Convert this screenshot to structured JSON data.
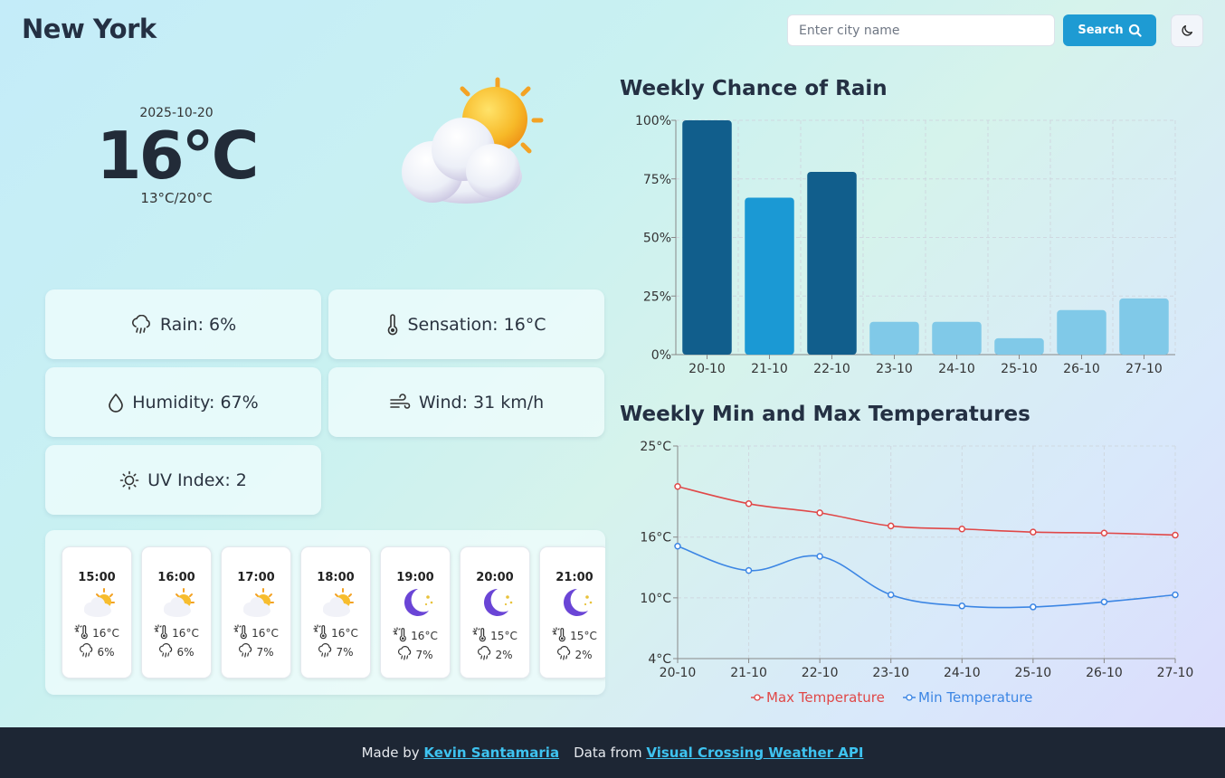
{
  "header": {
    "city": "New York",
    "search_placeholder": "Enter city name",
    "search_label": "Search"
  },
  "current": {
    "date": "2025-10-20",
    "temp": "16°C",
    "range": "13°C/20°C",
    "icon": "partly-cloudy-day-icon"
  },
  "details": {
    "rain": "Rain: 6%",
    "sensation": "Sensation: 16°C",
    "humidity": "Humidity: 67%",
    "wind": "Wind: 31 km/h",
    "uv": "UV Index: 2"
  },
  "hourly": [
    {
      "time": "15:00",
      "icon": "partly-cloudy-day",
      "temp": "16°C",
      "rain": "6%"
    },
    {
      "time": "16:00",
      "icon": "partly-cloudy-day",
      "temp": "16°C",
      "rain": "6%"
    },
    {
      "time": "17:00",
      "icon": "partly-cloudy-day",
      "temp": "16°C",
      "rain": "7%"
    },
    {
      "time": "18:00",
      "icon": "partly-cloudy-day",
      "temp": "16°C",
      "rain": "7%"
    },
    {
      "time": "19:00",
      "icon": "clear-night",
      "temp": "16°C",
      "rain": "7%"
    },
    {
      "time": "20:00",
      "icon": "clear-night",
      "temp": "15°C",
      "rain": "2%"
    },
    {
      "time": "21:00",
      "icon": "clear-night",
      "temp": "15°C",
      "rain": "2%"
    }
  ],
  "chart_data": [
    {
      "type": "bar",
      "title": "Weekly Chance of Rain",
      "categories": [
        "20-10",
        "21-10",
        "22-10",
        "23-10",
        "24-10",
        "25-10",
        "26-10",
        "27-10"
      ],
      "values": [
        100,
        67,
        78,
        14,
        14,
        7,
        19,
        24
      ],
      "ylim": [
        0,
        100
      ],
      "yticks": [
        "0%",
        "25%",
        "50%",
        "75%",
        "100%"
      ],
      "ytick_values": [
        0,
        25,
        50,
        75,
        100
      ],
      "grid": true,
      "colors": {
        "high": "#115e8c",
        "medium": "#1b99d4",
        "low": "#80c9e8"
      }
    },
    {
      "type": "line",
      "title": "Weekly Min and Max Temperatures",
      "categories": [
        "20-10",
        "21-10",
        "22-10",
        "23-10",
        "24-10",
        "25-10",
        "26-10",
        "27-10"
      ],
      "series": [
        {
          "name": "Max Temperature",
          "color": "#e04848",
          "values": [
            21,
            19.3,
            18.4,
            17.1,
            16.8,
            16.5,
            16.4,
            16.2
          ]
        },
        {
          "name": "Min Temperature",
          "color": "#3c86e4",
          "values": [
            15.1,
            12.7,
            14.1,
            10.3,
            9.2,
            9.1,
            9.6,
            10.3
          ]
        }
      ],
      "ylim": [
        4,
        25
      ],
      "yticks": [
        "4°C",
        "10°C",
        "16°C",
        "25°C"
      ],
      "ytick_values": [
        4,
        10,
        16,
        25
      ],
      "grid": true,
      "legend": "bottom"
    }
  ],
  "footer": {
    "made_by_prefix": "Made by",
    "author": "Kevin Santamaria",
    "data_prefix": "Data from",
    "source": "Visual Crossing Weather API"
  }
}
